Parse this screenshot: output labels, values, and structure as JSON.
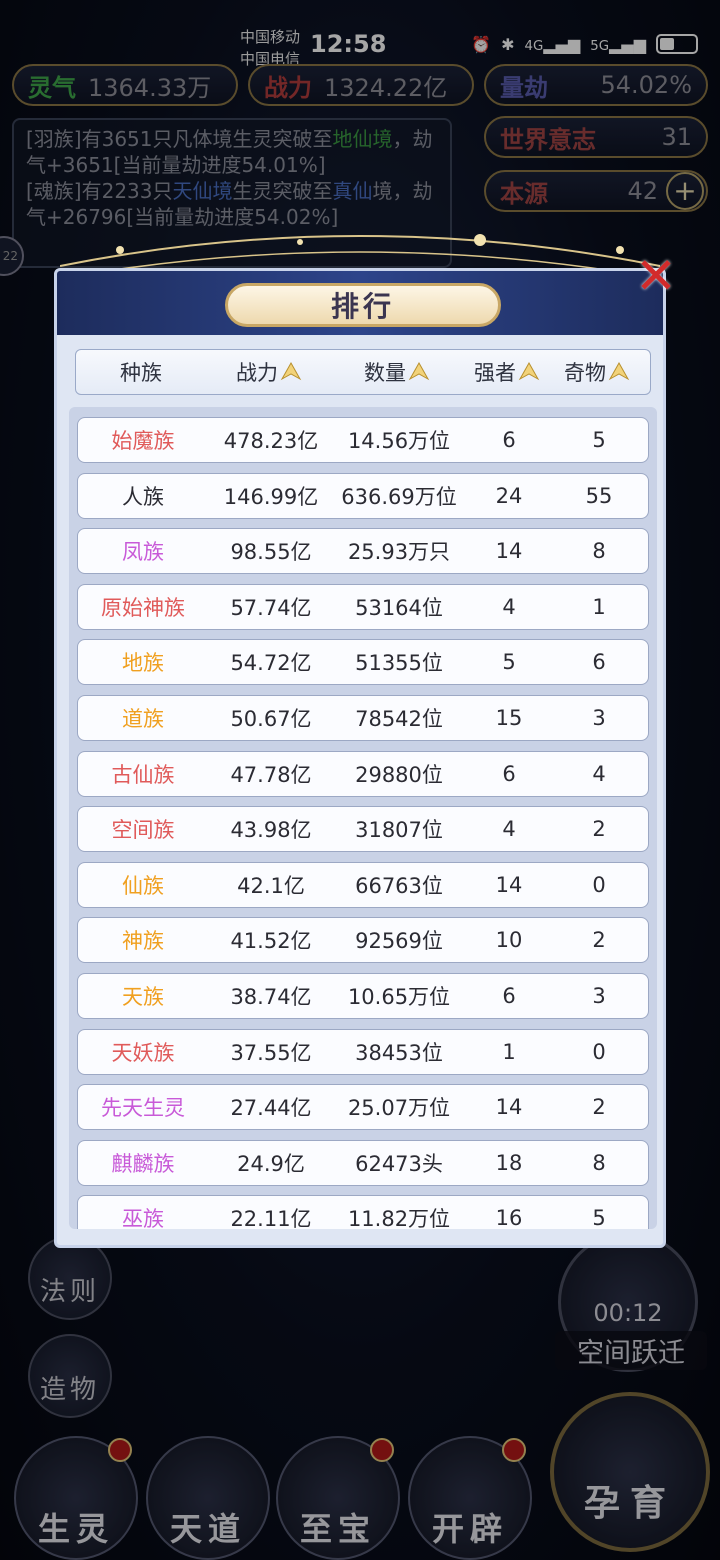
{
  "status_bar": {
    "carrier_1": "中国移动",
    "carrier_2": "中国电信",
    "time": "12:58",
    "net_1": "4G",
    "net_2": "5G"
  },
  "stats": {
    "lingqi_label": "灵气",
    "lingqi_value": "1364.33万",
    "zhanli_label": "战力",
    "zhanli_value": "1324.22亿",
    "liangjie_label": "量劫",
    "liangjie_value": "54.02%",
    "shijie_label": "世界意志",
    "shijie_value": "31",
    "benyuan_label": "本源",
    "benyuan_value": "42"
  },
  "log": {
    "l1_a": "[羽族]有3651只凡体境生灵突破至",
    "l1_b": "地仙",
    "l1_c": "境",
    "l1_d": "，劫气+3651[当前量劫进度54.01%]",
    "l2_a": "[魂族]有2233只",
    "l2_b": "天仙境",
    "l2_c": "生灵突破至",
    "l2_d": "真仙",
    "l2_e": "境，劫气+26796[当前量劫进度54.02%]"
  },
  "side_badge": "22",
  "side_buttons": {
    "fa_ze": "法则",
    "zao_wu": "造物",
    "space_jump_timer": "00:12",
    "space_jump_label": "空间跃迁"
  },
  "bottom_buttons": {
    "sheng_ling": "生灵",
    "tian_dao": "天道",
    "zhi_bao": "至宝",
    "kai_pi": "开辟",
    "yun_yu": "孕育"
  },
  "ranking": {
    "title": "排行",
    "headers": [
      "种族",
      "战力",
      "数量",
      "强者",
      "奇物"
    ],
    "rows": [
      {
        "race": "始魔族",
        "power": "478.23亿",
        "count": "14.56万位",
        "elite": "6",
        "treasure": "5",
        "color": "#e05a5a"
      },
      {
        "race": "人族",
        "power": "146.99亿",
        "count": "636.69万位",
        "elite": "24",
        "treasure": "55",
        "color": "#2b2b33"
      },
      {
        "race": "凤族",
        "power": "98.55亿",
        "count": "25.93万只",
        "elite": "14",
        "treasure": "8",
        "color": "#c85ad8"
      },
      {
        "race": "原始神族",
        "power": "57.74亿",
        "count": "53164位",
        "elite": "4",
        "treasure": "1",
        "color": "#e05a5a"
      },
      {
        "race": "地族",
        "power": "54.72亿",
        "count": "51355位",
        "elite": "5",
        "treasure": "6",
        "color": "#f0a020"
      },
      {
        "race": "道族",
        "power": "50.67亿",
        "count": "78542位",
        "elite": "15",
        "treasure": "3",
        "color": "#f0a020"
      },
      {
        "race": "古仙族",
        "power": "47.78亿",
        "count": "29880位",
        "elite": "6",
        "treasure": "4",
        "color": "#e05a5a"
      },
      {
        "race": "空间族",
        "power": "43.98亿",
        "count": "31807位",
        "elite": "4",
        "treasure": "2",
        "color": "#e05a5a"
      },
      {
        "race": "仙族",
        "power": "42.1亿",
        "count": "66763位",
        "elite": "14",
        "treasure": "0",
        "color": "#f0a020"
      },
      {
        "race": "神族",
        "power": "41.52亿",
        "count": "92569位",
        "elite": "10",
        "treasure": "2",
        "color": "#f0a020"
      },
      {
        "race": "天族",
        "power": "38.74亿",
        "count": "10.65万位",
        "elite": "6",
        "treasure": "3",
        "color": "#f0a020"
      },
      {
        "race": "天妖族",
        "power": "37.55亿",
        "count": "38453位",
        "elite": "1",
        "treasure": "0",
        "color": "#e05a5a"
      },
      {
        "race": "先天生灵",
        "power": "27.44亿",
        "count": "25.07万位",
        "elite": "14",
        "treasure": "2",
        "color": "#c85ad8"
      },
      {
        "race": "麒麟族",
        "power": "24.9亿",
        "count": "62473头",
        "elite": "18",
        "treasure": "8",
        "color": "#c85ad8"
      },
      {
        "race": "巫族",
        "power": "22.11亿",
        "count": "11.82万位",
        "elite": "16",
        "treasure": "5",
        "color": "#c85ad8"
      }
    ]
  }
}
